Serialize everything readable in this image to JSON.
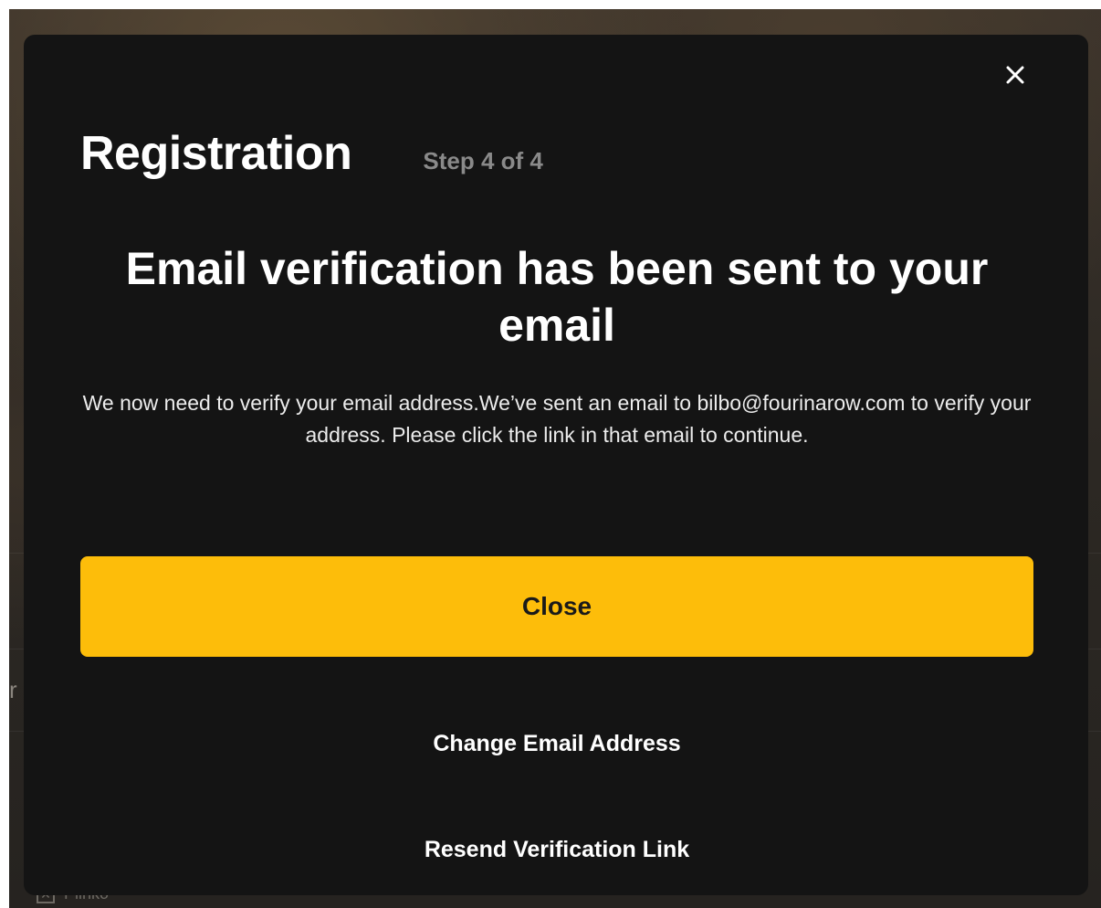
{
  "background": {
    "list_item_label": "Plinko"
  },
  "modal": {
    "title": "Registration",
    "step": "Step 4 of 4",
    "close_icon": "close-icon",
    "headline": "Email verification has been sent to your email",
    "body": "We now need to verify your email address.We’ve sent an email to bilbo@fourinarow.com to verify your address. Please click the link in that email to continue.",
    "primary_button_label": "Close",
    "change_email_label": "Change Email Address",
    "resend_link_label": "Resend Verification Link"
  },
  "colors": {
    "modal_background": "#141414",
    "accent": "#fdbd0a",
    "muted_text": "#8a8a8a"
  }
}
